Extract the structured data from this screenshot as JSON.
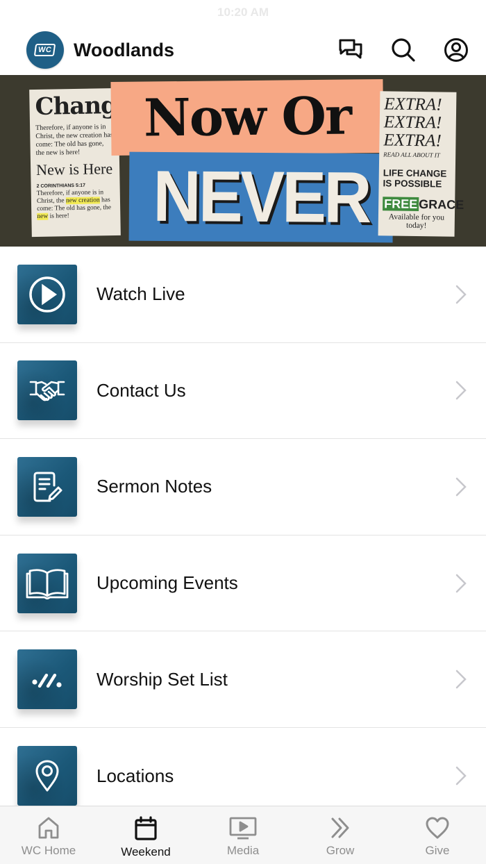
{
  "status_bar": {
    "time": "10:20 AM"
  },
  "header": {
    "logo_text": "WC",
    "title": "Woodlands",
    "icons": [
      "chat-icon",
      "search-icon",
      "account-icon"
    ]
  },
  "banner": {
    "left_paper": {
      "headline": "Change",
      "body": "Therefore, if anyone is in Christ, the new creation has come: The old has gone, the new is here!",
      "subhead": "New is Here",
      "reference": "2 CORINTHIANS 5:17",
      "body2_a": "Therefore, if anyone is in Christ, the ",
      "body2_highlight": "new creation",
      "body2_b": " has come: The old has gone, the ",
      "body2_highlight2": "new",
      "body2_c": " is here!"
    },
    "title_top": "Now Or",
    "title_bottom": "NEVER",
    "right_paper": {
      "extra_1": "EXTRA!",
      "extra_2": "EXTRA!",
      "extra_3": "EXTRA!",
      "read_all": "READ ALL ABOUT IT",
      "life_change": "LIFE CHANGE IS POSSIBLE",
      "free": "FREE",
      "grace": "GRACE",
      "available": "Available for you today!"
    }
  },
  "menu": {
    "items": [
      {
        "label": "Watch Live",
        "icon": "play-icon"
      },
      {
        "label": "Contact Us",
        "icon": "handshake-icon"
      },
      {
        "label": "Sermon Notes",
        "icon": "notes-edit-icon"
      },
      {
        "label": "Upcoming Events",
        "icon": "open-book-icon"
      },
      {
        "label": "Worship Set List",
        "icon": "set-list-icon"
      },
      {
        "label": "Locations",
        "icon": "location-pin-icon"
      }
    ]
  },
  "tab_bar": {
    "active": "Weekend",
    "tabs": [
      {
        "label": "WC Home",
        "icon": "home-icon"
      },
      {
        "label": "Weekend",
        "icon": "calendar-icon"
      },
      {
        "label": "Media",
        "icon": "media-play-icon"
      },
      {
        "label": "Grow",
        "icon": "double-chevron-icon"
      },
      {
        "label": "Give",
        "icon": "heart-icon"
      }
    ]
  },
  "colors": {
    "brand_blue": "#1f5f86",
    "banner_bg": "#3c3a2e",
    "banner_peach": "#f7a885",
    "banner_blue": "#3c7dbd",
    "inactive_tab": "#8e8e8e"
  }
}
